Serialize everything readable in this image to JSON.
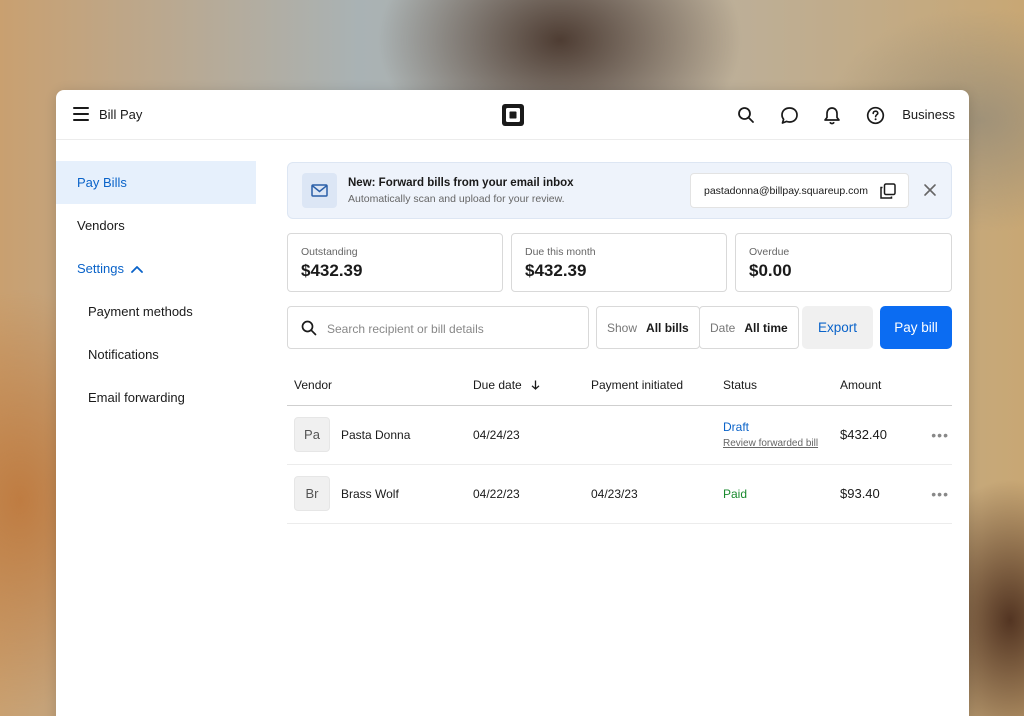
{
  "topbar": {
    "title": "Bill Pay",
    "logo_icon": "square-logo-icon",
    "icons": [
      "search-icon",
      "chat-icon",
      "bell-icon",
      "help-icon"
    ],
    "business_label": "Business"
  },
  "sidebar": {
    "items": [
      {
        "label": "Pay Bills",
        "active": true
      },
      {
        "label": "Vendors"
      },
      {
        "label": "Settings",
        "expanded": true
      },
      {
        "label": "Payment methods"
      },
      {
        "label": "Notifications"
      },
      {
        "label": "Email forwarding"
      }
    ]
  },
  "banner": {
    "title": "New: Forward bills from your email inbox",
    "subtitle": "Automatically scan and upload for your review.",
    "email": "pastadonna@billpay.squareup.com"
  },
  "stats": [
    {
      "label": "Outstanding",
      "value": "$432.39"
    },
    {
      "label": "Due this month",
      "value": "$432.39"
    },
    {
      "label": "Overdue",
      "value": "$0.00"
    }
  ],
  "toolbar": {
    "search_placeholder": "Search recipient or bill details",
    "show_key": "Show",
    "show_value": "All bills",
    "date_key": "Date",
    "date_value": "All time",
    "export_label": "Export",
    "pay_label": "Pay bill"
  },
  "table": {
    "headers": [
      "Vendor",
      "Due date",
      "Payment initiated",
      "Status",
      "Amount"
    ],
    "rows": [
      {
        "initials": "Pa",
        "vendor": "Pasta Donna",
        "due": "04/24/23",
        "initiated": "",
        "status": "Draft",
        "status_sub": "Review forwarded bill",
        "amount": "$432.40",
        "more": "•••"
      },
      {
        "initials": "Br",
        "vendor": "Brass Wolf",
        "due": "04/22/23",
        "initiated": "04/23/23",
        "status": "Paid",
        "status_sub": "",
        "amount": "$93.40",
        "more": "•••"
      }
    ]
  },
  "colors": {
    "accent": "#0b6cf2",
    "link": "#0a63c9",
    "paid": "#1a8a2e",
    "active_nav_bg": "#e6f0fc"
  }
}
